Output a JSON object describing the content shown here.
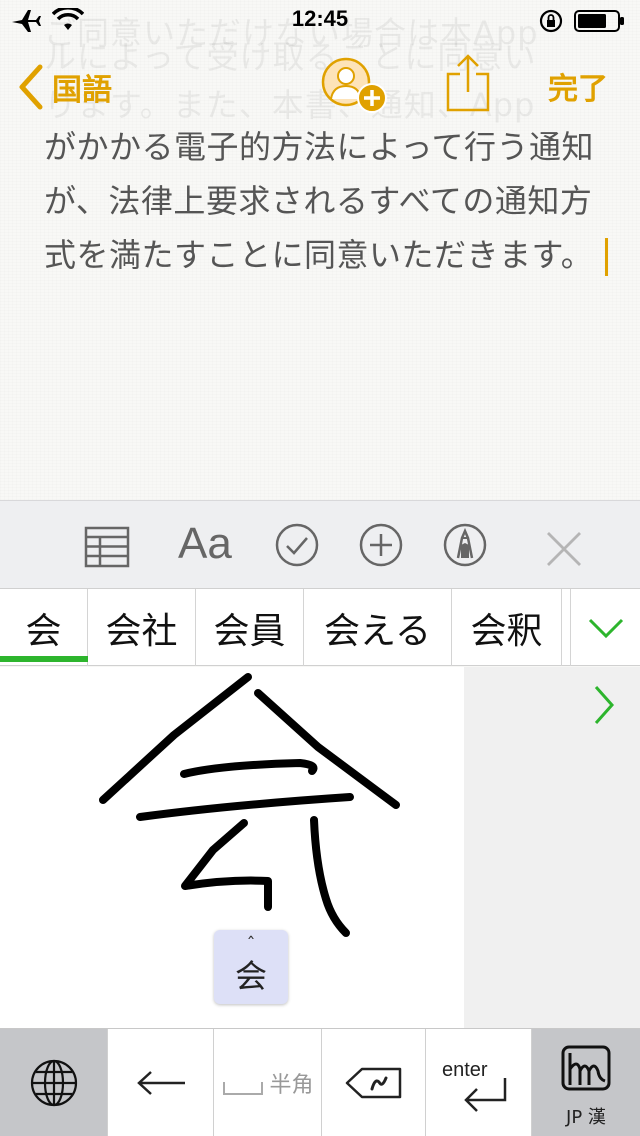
{
  "status_bar": {
    "time": "12:45"
  },
  "nav": {
    "back_label": "国語",
    "done_label": "完了"
  },
  "ghost_lines": [
    "ご同意いただけない場合は本App",
    "ルによって受け取ることに同意い",
    "ります。また、本書、通知、App"
  ],
  "note": {
    "lines": [
      "がかかる電子的方法によって行う通知",
      "が、法律上要求されるすべての通知方",
      "式を満たすことに同意いただきます。"
    ]
  },
  "toolbar": {
    "format_label": "Aa"
  },
  "candidates": [
    "会",
    "会社",
    "会員",
    "会える",
    "会釈"
  ],
  "handwriting": {
    "preview_caret": "ˆ",
    "preview_char": "会"
  },
  "keyboard": {
    "space_label": "半角",
    "enter_label": "enter",
    "mode_label": "JP 漢"
  },
  "colors": {
    "accent": "#e0a100",
    "candidate_underline": "#2db52d",
    "chevron": "#2db52d"
  }
}
